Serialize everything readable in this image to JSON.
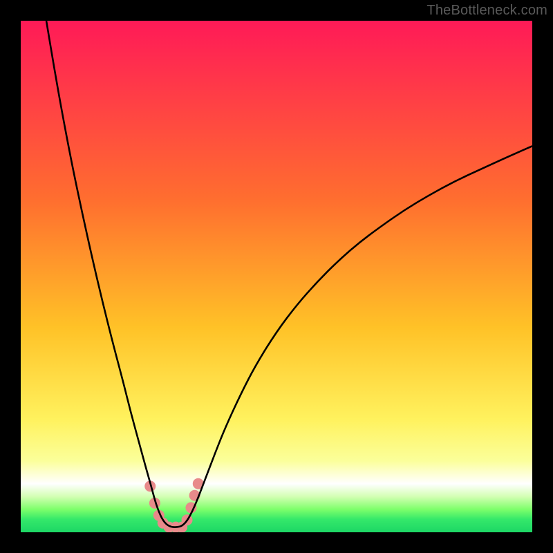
{
  "watermark": "TheBottleneck.com",
  "chart_data": {
    "type": "line",
    "title": "",
    "xlabel": "",
    "ylabel": "",
    "xlim": [
      0,
      100
    ],
    "ylim": [
      0,
      100
    ],
    "gradient_stops": [
      {
        "offset": 0.0,
        "color": "#ff1a57"
      },
      {
        "offset": 0.35,
        "color": "#ff6e2f"
      },
      {
        "offset": 0.6,
        "color": "#ffc227"
      },
      {
        "offset": 0.78,
        "color": "#fff25e"
      },
      {
        "offset": 0.86,
        "color": "#fbff9a"
      },
      {
        "offset": 0.905,
        "color": "#ffffff"
      },
      {
        "offset": 0.93,
        "color": "#d4ffb4"
      },
      {
        "offset": 0.955,
        "color": "#7eff6b"
      },
      {
        "offset": 0.975,
        "color": "#34e86a"
      },
      {
        "offset": 1.0,
        "color": "#1dd765"
      }
    ],
    "series": [
      {
        "name": "bottleneck-curve",
        "color": "#000000",
        "points": [
          {
            "x": 5.0,
            "y": 100.0
          },
          {
            "x": 6.5,
            "y": 91.0
          },
          {
            "x": 8.0,
            "y": 82.5
          },
          {
            "x": 10.0,
            "y": 72.0
          },
          {
            "x": 12.0,
            "y": 62.5
          },
          {
            "x": 14.0,
            "y": 53.5
          },
          {
            "x": 16.0,
            "y": 45.0
          },
          {
            "x": 18.0,
            "y": 37.0
          },
          {
            "x": 20.0,
            "y": 29.5
          },
          {
            "x": 21.5,
            "y": 23.5
          },
          {
            "x": 23.0,
            "y": 18.0
          },
          {
            "x": 24.5,
            "y": 12.5
          },
          {
            "x": 25.5,
            "y": 9.0
          },
          {
            "x": 26.3,
            "y": 6.0
          },
          {
            "x": 27.0,
            "y": 4.0
          },
          {
            "x": 27.7,
            "y": 2.5
          },
          {
            "x": 28.5,
            "y": 1.5
          },
          {
            "x": 29.5,
            "y": 1.0
          },
          {
            "x": 30.5,
            "y": 1.0
          },
          {
            "x": 31.5,
            "y": 1.2
          },
          {
            "x": 32.5,
            "y": 2.2
          },
          {
            "x": 33.5,
            "y": 4.0
          },
          {
            "x": 34.5,
            "y": 6.3
          },
          {
            "x": 36.0,
            "y": 10.2
          },
          {
            "x": 38.0,
            "y": 15.5
          },
          {
            "x": 40.0,
            "y": 20.5
          },
          {
            "x": 43.0,
            "y": 27.0
          },
          {
            "x": 46.0,
            "y": 32.8
          },
          {
            "x": 50.0,
            "y": 39.2
          },
          {
            "x": 54.0,
            "y": 44.5
          },
          {
            "x": 58.0,
            "y": 49.0
          },
          {
            "x": 62.0,
            "y": 53.0
          },
          {
            "x": 66.0,
            "y": 56.5
          },
          {
            "x": 70.0,
            "y": 59.5
          },
          {
            "x": 75.0,
            "y": 63.0
          },
          {
            "x": 80.0,
            "y": 66.0
          },
          {
            "x": 85.0,
            "y": 68.7
          },
          {
            "x": 90.0,
            "y": 71.0
          },
          {
            "x": 95.0,
            "y": 73.3
          },
          {
            "x": 100.0,
            "y": 75.5
          }
        ]
      }
    ],
    "markers": {
      "name": "curve-markers",
      "color": "#e88a8a",
      "radius": 8,
      "points": [
        {
          "x": 25.3,
          "y": 9.0
        },
        {
          "x": 26.2,
          "y": 5.7
        },
        {
          "x": 27.0,
          "y": 3.3
        },
        {
          "x": 27.8,
          "y": 1.8
        },
        {
          "x": 29.0,
          "y": 1.0
        },
        {
          "x": 30.3,
          "y": 1.0
        },
        {
          "x": 31.5,
          "y": 1.0
        },
        {
          "x": 32.5,
          "y": 2.4
        },
        {
          "x": 33.3,
          "y": 4.8
        },
        {
          "x": 34.0,
          "y": 7.2
        },
        {
          "x": 34.7,
          "y": 9.5
        }
      ]
    }
  }
}
